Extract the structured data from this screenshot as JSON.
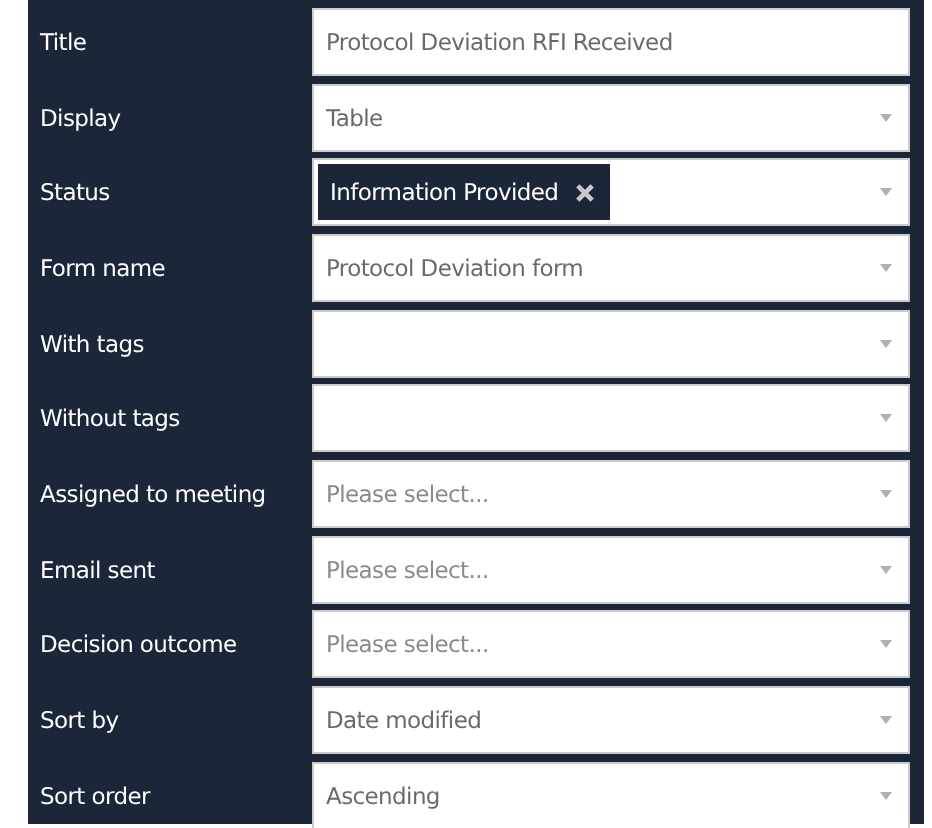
{
  "filters": [
    {
      "label": "Title",
      "kind": "text",
      "value": "Protocol Deviation RFI Received"
    },
    {
      "label": "Display",
      "kind": "select",
      "value": "Table"
    },
    {
      "label": "Status",
      "kind": "tags",
      "tags": [
        "Information Provided"
      ]
    },
    {
      "label": "Form name",
      "kind": "select",
      "value": "Protocol Deviation form"
    },
    {
      "label": "With tags",
      "kind": "select"
    },
    {
      "label": "Without tags",
      "kind": "select"
    },
    {
      "label": "Assigned to meeting",
      "kind": "select",
      "placeholder": "Please select..."
    },
    {
      "label": "Email sent",
      "kind": "select",
      "placeholder": "Please select..."
    },
    {
      "label": "Decision outcome",
      "kind": "select",
      "placeholder": "Please select..."
    },
    {
      "label": "Sort by",
      "kind": "select",
      "value": "Date modified"
    },
    {
      "label": "Sort order",
      "kind": "select",
      "value": "Ascending"
    }
  ]
}
